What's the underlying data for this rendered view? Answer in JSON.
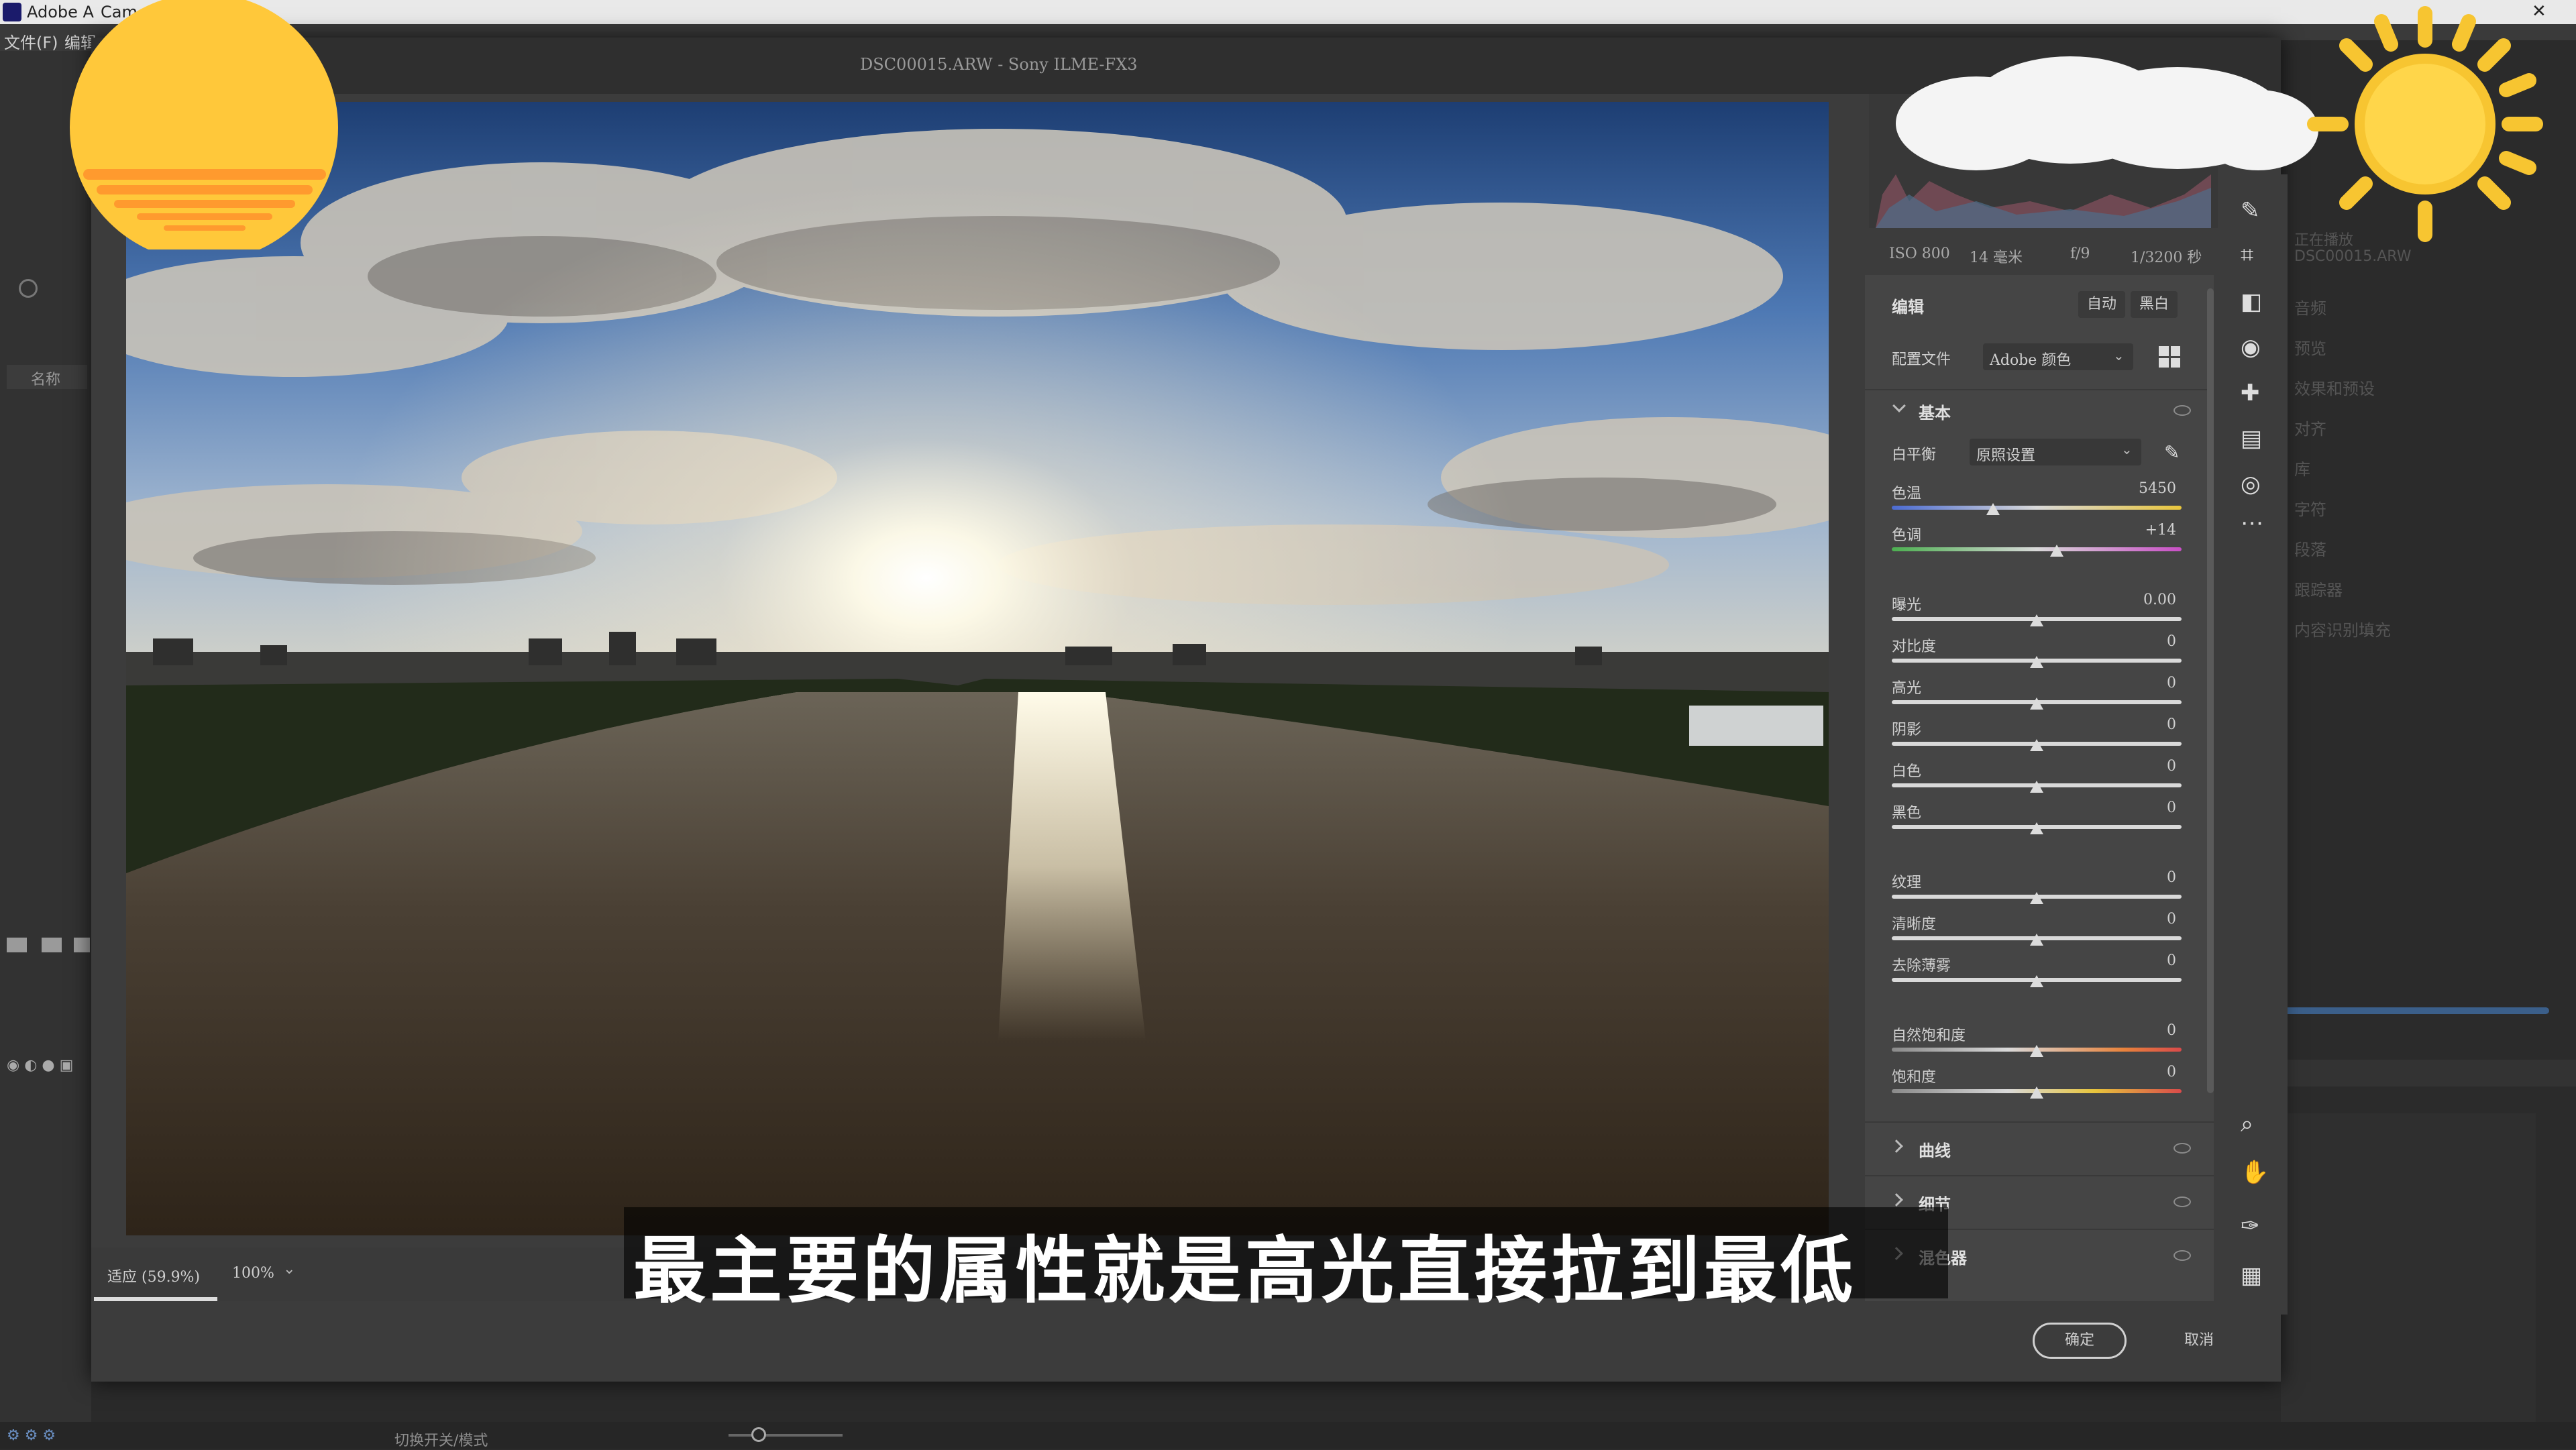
{
  "host": {
    "app_title": "Adobe A",
    "app_title_suffix": "Cam",
    "menu": [
      "文件(F)",
      "编辑"
    ],
    "name_column": "名称",
    "status_text": "切换开关/模式",
    "right_panel_items": [
      "正在播放",
      "DSC00015.ARW",
      "音频",
      "预览",
      "效果和预设",
      "对齐",
      "库",
      "字符",
      "段落",
      "跟踪器",
      "内容识别填充"
    ]
  },
  "dialog": {
    "title": "DSC00015.ARW  -  Sony ILME-FX3",
    "zoom_fit": "适应 (59.9%)",
    "zoom_level": "100%",
    "ok_label": "确定",
    "cancel_label": "取消"
  },
  "exif": {
    "iso": "ISO 800",
    "focal": "14 毫米",
    "aperture": "f/9",
    "shutter": "1/3200 秒"
  },
  "edit": {
    "header": "编辑",
    "auto_label": "自动",
    "bw_label": "黑白",
    "profile_label": "配置文件",
    "profile_value": "Adobe 颜色",
    "basic_header": "基本",
    "wb_label": "白平衡",
    "wb_value": "原照设置",
    "sliders": [
      {
        "label": "色温",
        "value": "5450",
        "position": 0.35
      },
      {
        "label": "色调",
        "value": "+14",
        "position": 0.57
      },
      {
        "label": "曝光",
        "value": "0.00",
        "position": 0.5
      },
      {
        "label": "对比度",
        "value": "0",
        "position": 0.5
      },
      {
        "label": "高光",
        "value": "0",
        "position": 0.5
      },
      {
        "label": "阴影",
        "value": "0",
        "position": 0.5
      },
      {
        "label": "白色",
        "value": "0",
        "position": 0.5
      },
      {
        "label": "黑色",
        "value": "0",
        "position": 0.5
      },
      {
        "label": "纹理",
        "value": "0",
        "position": 0.5
      },
      {
        "label": "清晰度",
        "value": "0",
        "position": 0.5
      },
      {
        "label": "去除薄雾",
        "value": "0",
        "position": 0.5
      },
      {
        "label": "自然饱和度",
        "value": "0",
        "position": 0.5
      },
      {
        "label": "饱和度",
        "value": "0",
        "position": 0.5
      }
    ],
    "sections": [
      "曲线",
      "细节",
      "混色器"
    ]
  },
  "subtitle": "最主要的属性就是高光直接拉到最低",
  "colors": {
    "accent_blue": "#2d7fd6",
    "panel": "#454545",
    "subtitle": "#ffffff"
  }
}
